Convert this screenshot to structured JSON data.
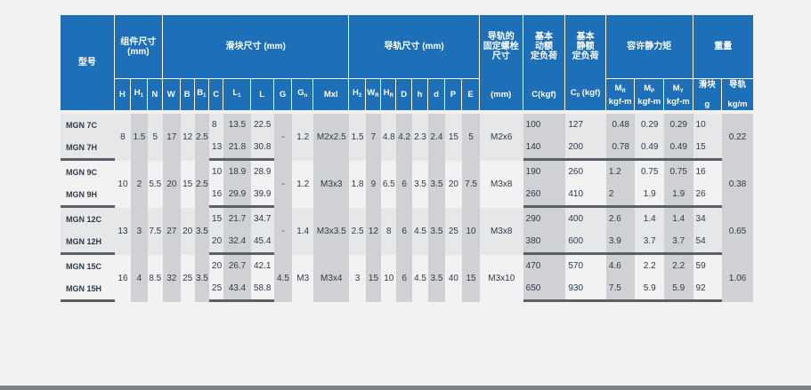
{
  "header": {
    "model": "型号",
    "assembly_size": "组件尺寸",
    "assembly_unit": "(mm)",
    "block_size": "滑块尺寸 (mm)",
    "rail_size": "导轨尺寸 (mm)",
    "rail_bolt": [
      "导轨的",
      "固定螺栓",
      "尺寸"
    ],
    "dynamic_load": [
      "基本",
      "动额",
      "定负荷"
    ],
    "static_load": [
      "基本",
      "静额",
      "定负荷"
    ],
    "static_moment": "容许静力矩",
    "weight": "重量",
    "sub": {
      "H": "H",
      "H1": "H",
      "N": "N",
      "W": "W",
      "B": "B",
      "B1": "B",
      "C": "C",
      "L1": "L",
      "L": "L",
      "G": "G",
      "Gn": "G",
      "Mxl": "Mxl",
      "H2": "H",
      "WR": "W",
      "HR": "H",
      "D": "D",
      "h": "h",
      "d": "d",
      "P": "P",
      "E": "E",
      "bolt_unit": "(mm)",
      "C_kgf": "C(kgf)",
      "C0_kgf": "C (kgf)",
      "MR": "M",
      "MP": "M",
      "MY": "M",
      "moment_unit": "kgf-m",
      "block": "滑块",
      "rail": "导轨",
      "block_unit": "g",
      "rail_unit": "kg/m"
    }
  },
  "groups": [
    {
      "models": [
        "MGN 7C",
        "MGN 7H"
      ],
      "H": "8",
      "H1": "1.5",
      "N": "5",
      "W": "17",
      "B": "12",
      "B1": "2.5",
      "C": [
        "8",
        "13"
      ],
      "L1": [
        "13.5",
        "21.8"
      ],
      "L": [
        "22.5",
        "30.8"
      ],
      "G": "-",
      "Gn": "1.2",
      "Mxl": "M2x2.5",
      "H2": "1.5",
      "WR": "7",
      "HR": "4.8",
      "D": "4.2",
      "h": "2.3",
      "d": "2.4",
      "P": "15",
      "E": "5",
      "bolt": "M2x6",
      "C_kgf": [
        "100",
        "140"
      ],
      "C0_kgf": [
        "127",
        "200"
      ],
      "MR": [
        "0.48",
        "0.78"
      ],
      "MP": [
        "0.29",
        "0.49"
      ],
      "MY": [
        "0.29",
        "0.49"
      ],
      "block_g": [
        "10",
        "15"
      ],
      "rail_kgm": "0.22"
    },
    {
      "models": [
        "MGN 9C",
        "MGN 9H"
      ],
      "H": "10",
      "H1": "2",
      "N": "5.5",
      "W": "20",
      "B": "15",
      "B1": "2.5",
      "C": [
        "10",
        "16"
      ],
      "L1": [
        "18.9",
        "29.9"
      ],
      "L": [
        "28.9",
        "39.9"
      ],
      "G": "-",
      "Gn": "1.2",
      "Mxl": "M3x3",
      "H2": "1.8",
      "WR": "9",
      "HR": "6.5",
      "D": "6",
      "h": "3.5",
      "d": "3.5",
      "P": "20",
      "E": "7.5",
      "bolt": "M3x8",
      "C_kgf": [
        "190",
        "260"
      ],
      "C0_kgf": [
        "260",
        "410"
      ],
      "MR": [
        "1.2",
        "2"
      ],
      "MP": [
        "0.75",
        "1.9"
      ],
      "MY": [
        "0.75",
        "1.9"
      ],
      "block_g": [
        "16",
        "26"
      ],
      "rail_kgm": "0.38"
    },
    {
      "models": [
        "MGN 12C",
        "MGN 12H"
      ],
      "H": "13",
      "H1": "3",
      "N": "7.5",
      "W": "27",
      "B": "20",
      "B1": "3.5",
      "C": [
        "15",
        "20"
      ],
      "L1": [
        "21.7",
        "32.4"
      ],
      "L": [
        "34.7",
        "45.4"
      ],
      "G": "-",
      "Gn": "1.4",
      "Mxl": "M3x3.5",
      "H2": "2.5",
      "WR": "12",
      "HR": "8",
      "D": "6",
      "h": "4.5",
      "d": "3.5",
      "P": "25",
      "E": "10",
      "bolt": "M3x8",
      "C_kgf": [
        "290",
        "380"
      ],
      "C0_kgf": [
        "400",
        "600"
      ],
      "MR": [
        "2.6",
        "3.9"
      ],
      "MP": [
        "1.4",
        "3.7"
      ],
      "MY": [
        "1.4",
        "3.7"
      ],
      "block_g": [
        "34",
        "54"
      ],
      "rail_kgm": "0.65"
    },
    {
      "models": [
        "MGN 15C",
        "MGN 15H"
      ],
      "H": "16",
      "H1": "4",
      "N": "8.5",
      "W": "32",
      "B": "25",
      "B1": "3.5",
      "C": [
        "20",
        "25"
      ],
      "L1": [
        "26.7",
        "43.4"
      ],
      "L": [
        "42.1",
        "58.8"
      ],
      "G": "4.5",
      "Gn": "M3",
      "Mxl": "M3x4",
      "H2": "3",
      "WR": "15",
      "HR": "10",
      "D": "6",
      "h": "4.5",
      "d": "3.5",
      "P": "40",
      "E": "15",
      "bolt": "M3x10",
      "C_kgf": [
        "470",
        "650"
      ],
      "C0_kgf": [
        "570",
        "930"
      ],
      "MR": [
        "4.6",
        "7.5"
      ],
      "MP": [
        "2.2",
        "5.9"
      ],
      "MY": [
        "2.2",
        "5.9"
      ],
      "block_g": [
        "59",
        "92"
      ],
      "rail_kgm": "1.06"
    }
  ]
}
